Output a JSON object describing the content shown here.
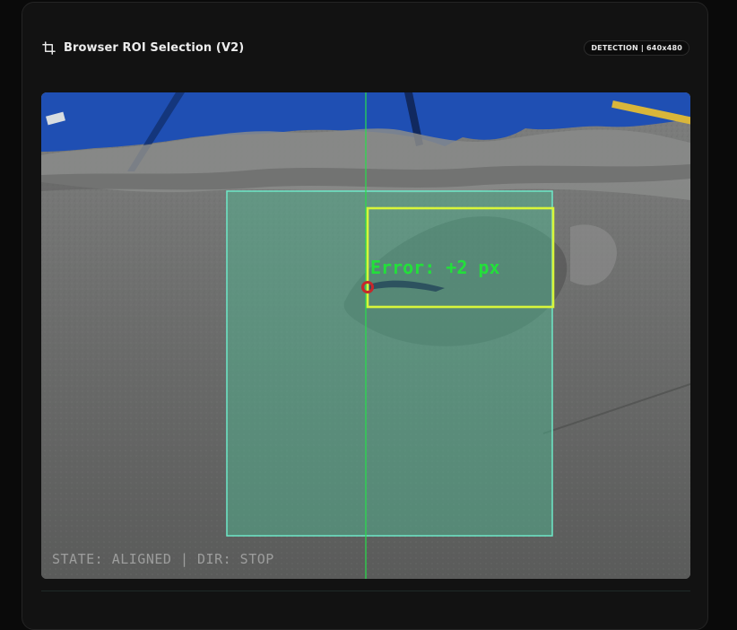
{
  "header": {
    "icon": "crop-icon",
    "title": "Browser ROI Selection (V2)",
    "badge": "DETECTION | 640x480"
  },
  "overlay": {
    "error_label": "Error: +2 px",
    "status_line": "STATE: ALIGNED | DIR: STOP"
  },
  "colors": {
    "roi_fill": "#4fb892",
    "roi_border": "#6ee8c8",
    "center_line": "#27e04a",
    "detection_box": "#d8f53a",
    "error_text": "#22e03a",
    "target_point": "#c6282b",
    "tarp_blue": "#1f4fb3"
  }
}
